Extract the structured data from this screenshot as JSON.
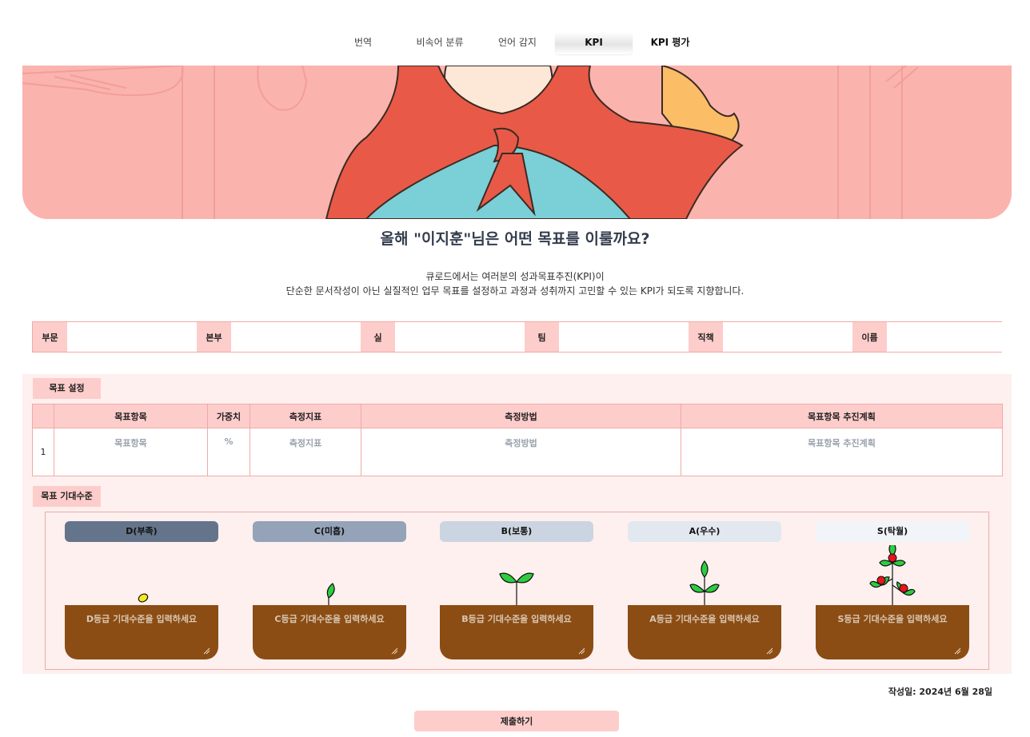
{
  "nav": {
    "tabs": [
      {
        "label": "번역"
      },
      {
        "label": "비속어 분류"
      },
      {
        "label": "언어 감지"
      },
      {
        "label": "KPI"
      },
      {
        "label": "KPI 평가"
      }
    ],
    "active_tab": "KPI"
  },
  "banner": {
    "background_color": "#fbb3ae",
    "illustration": "girl-with-red-scarf"
  },
  "headline": "올해 \"이지훈\"님은 어떤 목표를 이룰까요?",
  "intro": {
    "line1": "큐로드에서는 여러분의 성과목표추진(KPI)이",
    "line2": "단순한 문서작성이 아닌 실질적인 업무 목표를 설정하고 과정과 성취까지 고민할 수 있는 KPI가 되도록 지향합니다."
  },
  "info_fields": [
    {
      "label": "부문",
      "value": ""
    },
    {
      "label": "본부",
      "value": ""
    },
    {
      "label": "실",
      "value": ""
    },
    {
      "label": "팀",
      "value": ""
    },
    {
      "label": "직책",
      "value": ""
    },
    {
      "label": "이름",
      "value": ""
    }
  ],
  "goal_setting": {
    "section_label": "목표 설정",
    "columns": [
      "",
      "목표항목",
      "가중치",
      "측정지표",
      "측정방법",
      "목표항목 추진계획"
    ],
    "rows": [
      {
        "number": "1",
        "placeholders": [
          "목표항목",
          "%",
          "측정지표",
          "측정방법",
          "목표항목 추진계획"
        ]
      }
    ]
  },
  "expectation": {
    "section_label": "목표 기대수준",
    "grades": [
      {
        "label": "D(부족)",
        "placeholder": "D등급 기대수준을 입력하세요",
        "badge_color": "#64748b",
        "plant_stage": "seed"
      },
      {
        "label": "C(미흡)",
        "placeholder": "C등급 기대수준을 입력하세요",
        "badge_color": "#94a3b8",
        "plant_stage": "sprout"
      },
      {
        "label": "B(보통)",
        "placeholder": "B등급 기대수준을 입력하세요",
        "badge_color": "#cbd5e1",
        "plant_stage": "two-leaves"
      },
      {
        "label": "A(우수)",
        "placeholder": "A등급 기대수준을 입력하세요",
        "badge_color": "#e2e8f0",
        "plant_stage": "seedling"
      },
      {
        "label": "S(탁월)",
        "placeholder": "S등급 기대수준을 입력하세요",
        "badge_color": "#f1f5f9",
        "plant_stage": "fruiting-plant"
      }
    ],
    "soil_color": "#8b4d14"
  },
  "created_date": "작성일: 2024년 6월 28일",
  "submit_label": "제출하기",
  "colors": {
    "accent_pink": "#fdcdcb",
    "border_pink": "#f2a9a6",
    "section_bg": "#fdf0ef"
  }
}
